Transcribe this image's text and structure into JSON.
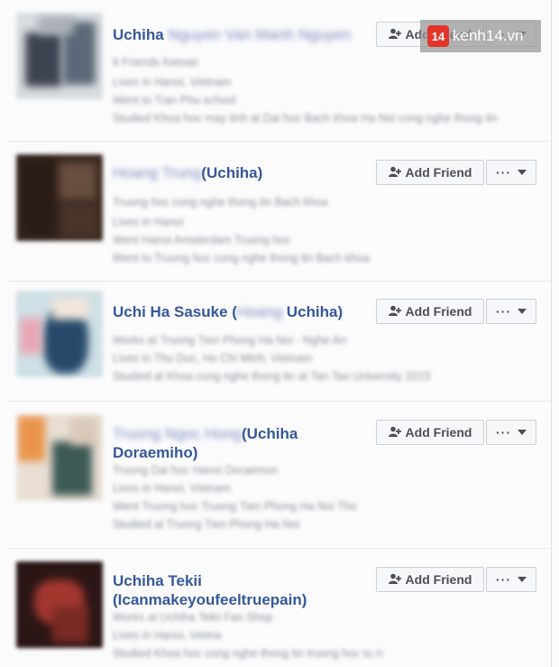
{
  "results": [
    {
      "name_prefix": "Uchiha",
      "name_blurred": "Nguyen Van Manh Nguyen",
      "name_suffix": "",
      "meta": [
        "6 Friends Ketoan",
        "Lives in Hanoi, Vietnam",
        "Went to Tran Phu school",
        "Studied Khoa hoc may tinh at Dai hoc Bach khoa Ha Noi cong nghe thong tin"
      ],
      "add_label": "Add Friend",
      "more_label": "···"
    },
    {
      "name_prefix": "",
      "name_blurred": "Hoang Trung",
      "name_suffix": "(Uchiha)",
      "meta": [
        "Truong hoc cong nghe thong tin Bach khoa",
        "Lives in Hanoi",
        "Went Hanoi Amsterdam Truong hoc",
        "Went to Truong hoc cong nghe thong tin Bach khoa"
      ],
      "add_label": "Add Friend",
      "more_label": "···"
    },
    {
      "name_prefix": "Uchi Ha Sasuke (",
      "name_blurred": "Hoang",
      "name_suffix": "Uchiha)",
      "meta": [
        "Works at Truong Tien Phong Ha Noi - Nghe An",
        "Lives in Thu Duc, Ho Chi Minh, Vietnam",
        "Studied at Khoa cong nghe thong tin at Tan Tao University 2015"
      ],
      "add_label": "Add Friend",
      "more_label": "···"
    },
    {
      "name_prefix": "",
      "name_blurred": "Truong Ngoc Hong",
      "name_suffix": "(Uchiha Doraemiho)",
      "meta": [
        "Truong Dai hoc Hanoi Doraemon",
        "Lives in Hanoi, Vietnam",
        "Went Truong hoc Truong Tien Phong Ha Noi Tho",
        "Studied at Truong Tien Phong Ha Noi"
      ],
      "add_label": "Add Friend",
      "more_label": "···"
    },
    {
      "name_prefix": "Uchiha Tekii (Icanmakeyoufeeltruepain)",
      "name_blurred": "",
      "name_suffix": "",
      "meta": [
        "Works at Uchiha Tekii Fan Shop",
        "Lives in Hanoi, Vietnam",
        "Studied Khoa hoc cong nghe thong tin truong hoc tu nhien"
      ],
      "add_label": "Add Friend",
      "more_label": "···"
    }
  ],
  "watermark": {
    "badge": "14",
    "text": "kenh14.vn"
  },
  "icons": {
    "add_friend": "person-plus-icon",
    "more": "ellipsis-icon",
    "dropdown": "caret-down-icon"
  }
}
